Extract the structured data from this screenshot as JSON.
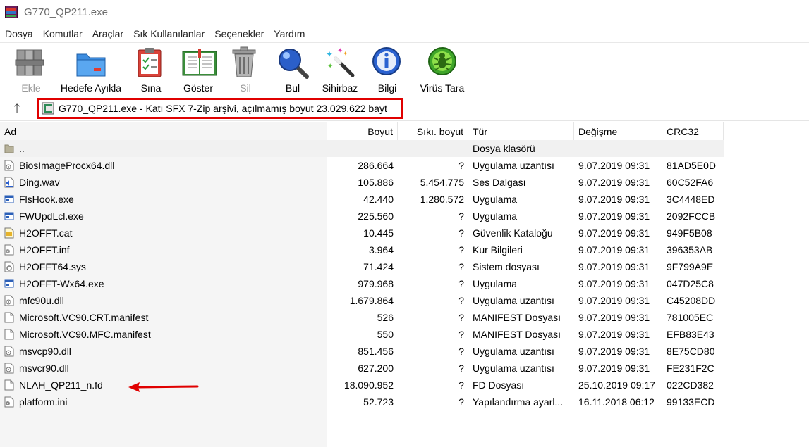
{
  "window": {
    "title": "G770_QP211.exe"
  },
  "menu": [
    "Dosya",
    "Komutlar",
    "Araçlar",
    "Sık Kullanılanlar",
    "Seçenekler",
    "Yardım"
  ],
  "toolbar": {
    "add": "Ekle",
    "extract": "Hedefe Ayıkla",
    "test": "Sına",
    "view": "Göster",
    "delete": "Sil",
    "find": "Bul",
    "wizard": "Sihirbaz",
    "info": "Bilgi",
    "virus": "Virüs Tara"
  },
  "address": {
    "text": "G770_QP211.exe - Katı SFX 7-Zip arşivi, açılmamış boyut 23.029.622 bayt"
  },
  "columns": {
    "name": "Ad",
    "size": "Boyut",
    "packed": "Sıkı. boyut",
    "type": "Tür",
    "modified": "Değişme",
    "crc": "CRC32"
  },
  "files": [
    {
      "name": "..",
      "size": "",
      "packed": "",
      "type": "Dosya klasörü",
      "modified": "",
      "crc": "",
      "icon": "folder-up-icon"
    },
    {
      "name": "BiosImageProcx64.dll",
      "size": "286.664",
      "packed": "?",
      "type": "Uygulama uzantısı",
      "modified": "9.07.2019 09:31",
      "crc": "81AD5E0D",
      "icon": "dll-icon"
    },
    {
      "name": "Ding.wav",
      "size": "105.886",
      "packed": "5.454.775",
      "type": "Ses Dalgası",
      "modified": "9.07.2019 09:31",
      "crc": "60C52FA6",
      "icon": "wav-icon"
    },
    {
      "name": "FlsHook.exe",
      "size": "42.440",
      "packed": "1.280.572",
      "type": "Uygulama",
      "modified": "9.07.2019 09:31",
      "crc": "3C4448ED",
      "icon": "exe-icon"
    },
    {
      "name": "FWUpdLcl.exe",
      "size": "225.560",
      "packed": "?",
      "type": "Uygulama",
      "modified": "9.07.2019 09:31",
      "crc": "2092FCCB",
      "icon": "exe-icon"
    },
    {
      "name": "H2OFFT.cat",
      "size": "10.445",
      "packed": "?",
      "type": "Güvenlik Kataloğu",
      "modified": "9.07.2019 09:31",
      "crc": "949F5B08",
      "icon": "catalog-icon"
    },
    {
      "name": "H2OFFT.inf",
      "size": "3.964",
      "packed": "?",
      "type": "Kur Bilgileri",
      "modified": "9.07.2019 09:31",
      "crc": "396353AB",
      "icon": "inf-icon"
    },
    {
      "name": "H2OFFT64.sys",
      "size": "71.424",
      "packed": "?",
      "type": "Sistem dosyası",
      "modified": "9.07.2019 09:31",
      "crc": "9F799A9E",
      "icon": "sys-icon"
    },
    {
      "name": "H2OFFT-Wx64.exe",
      "size": "979.968",
      "packed": "?",
      "type": "Uygulama",
      "modified": "9.07.2019 09:31",
      "crc": "047D25C8",
      "icon": "exe-icon"
    },
    {
      "name": "mfc90u.dll",
      "size": "1.679.864",
      "packed": "?",
      "type": "Uygulama uzantısı",
      "modified": "9.07.2019 09:31",
      "crc": "C45208DD",
      "icon": "dll-icon"
    },
    {
      "name": "Microsoft.VC90.CRT.manifest",
      "size": "526",
      "packed": "?",
      "type": "MANIFEST Dosyası",
      "modified": "9.07.2019 09:31",
      "crc": "781005EC",
      "icon": "blank-file-icon"
    },
    {
      "name": "Microsoft.VC90.MFC.manifest",
      "size": "550",
      "packed": "?",
      "type": "MANIFEST Dosyası",
      "modified": "9.07.2019 09:31",
      "crc": "EFB83E43",
      "icon": "blank-file-icon"
    },
    {
      "name": "msvcp90.dll",
      "size": "851.456",
      "packed": "?",
      "type": "Uygulama uzantısı",
      "modified": "9.07.2019 09:31",
      "crc": "8E75CD80",
      "icon": "dll-icon"
    },
    {
      "name": "msvcr90.dll",
      "size": "627.200",
      "packed": "?",
      "type": "Uygulama uzantısı",
      "modified": "9.07.2019 09:31",
      "crc": "FE231F2C",
      "icon": "dll-icon"
    },
    {
      "name": "NLAH_QP211_n.fd",
      "size": "18.090.952",
      "packed": "?",
      "type": "FD Dosyası",
      "modified": "25.10.2019 09:17",
      "crc": "022CD382",
      "icon": "blank-file-icon"
    },
    {
      "name": "platform.ini",
      "size": "52.723",
      "packed": "?",
      "type": "Yapılandırma ayarl...",
      "modified": "16.11.2018 06:12",
      "crc": "99133ECD",
      "icon": "ini-icon"
    }
  ],
  "colors": {
    "highlight_border": "#e00000",
    "annotation_arrow": "#e00000"
  }
}
